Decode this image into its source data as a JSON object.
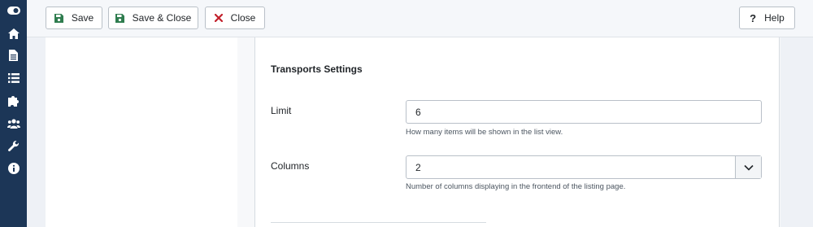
{
  "toolbar": {
    "save_label": "Save",
    "save_close_label": "Save & Close",
    "close_label": "Close",
    "help_label": "Help"
  },
  "sidebar": {
    "items": [
      {
        "icon": "toggle-icon"
      },
      {
        "icon": "home-icon"
      },
      {
        "icon": "file-icon"
      },
      {
        "icon": "list-icon"
      },
      {
        "icon": "puzzle-icon"
      },
      {
        "icon": "users-icon"
      },
      {
        "icon": "wrench-icon"
      },
      {
        "icon": "info-icon"
      }
    ]
  },
  "form": {
    "section_title": "Transports Settings",
    "limit": {
      "label": "Limit",
      "value": "6",
      "help": "How many items will be shown in the list view."
    },
    "columns": {
      "label": "Columns",
      "value": "2",
      "help": "Number of columns displaying in the frontend of the listing page."
    }
  },
  "colors": {
    "sidebar_bg": "#1c3657",
    "save_icon": "#2f7d4f",
    "close_icon": "#c2202b"
  }
}
